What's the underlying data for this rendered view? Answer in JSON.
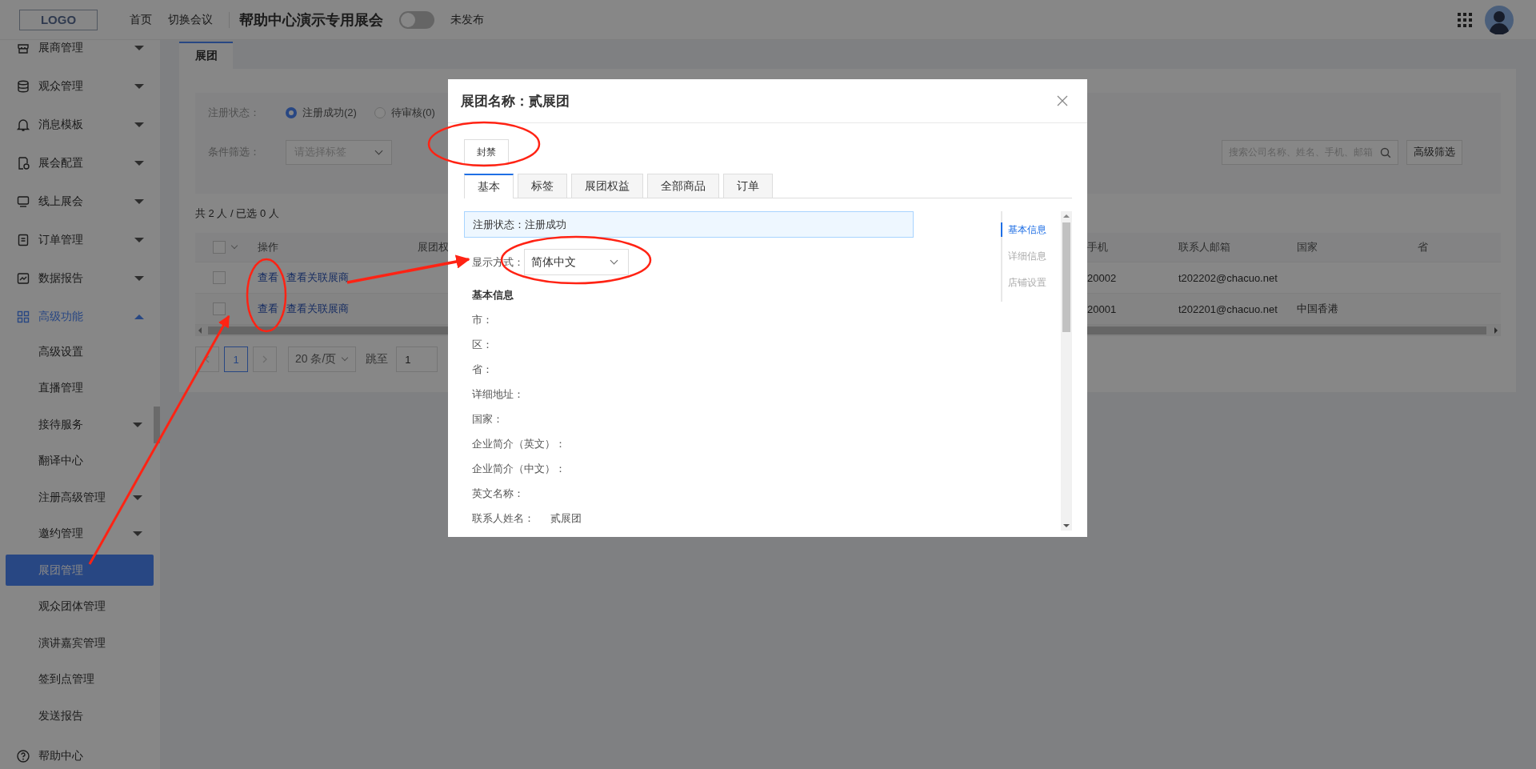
{
  "header": {
    "logo": "LOGO",
    "nav": [
      {
        "label": "首页"
      },
      {
        "label": "切换会议"
      }
    ],
    "event_title": "帮助中心演示专用展会",
    "publish_toggle": {
      "on": false
    },
    "publish_status": "未发布"
  },
  "sidebar": {
    "items": [
      {
        "label": "展商管理",
        "kind": "menu",
        "expanded": false
      },
      {
        "label": "观众管理",
        "kind": "menu",
        "expanded": false
      },
      {
        "label": "消息模板",
        "kind": "menu",
        "expanded": false
      },
      {
        "label": "展会配置",
        "kind": "menu",
        "expanded": false
      },
      {
        "label": "线上展会",
        "kind": "menu",
        "expanded": false
      },
      {
        "label": "订单管理",
        "kind": "menu",
        "expanded": false
      },
      {
        "label": "数据报告",
        "kind": "menu",
        "expanded": false
      },
      {
        "label": "高级功能",
        "kind": "menu",
        "expanded": true,
        "children": [
          {
            "label": "高级设置",
            "kind": "page",
            "selected": false
          },
          {
            "label": "直播管理",
            "kind": "page",
            "selected": false
          },
          {
            "label": "接待服务",
            "kind": "menu",
            "expanded": false,
            "selected": false
          },
          {
            "label": "翻译中心",
            "kind": "page",
            "selected": false
          },
          {
            "label": "注册高级管理",
            "kind": "menu",
            "expanded": false,
            "selected": false
          },
          {
            "label": "邀约管理",
            "kind": "menu",
            "expanded": false,
            "selected": false
          },
          {
            "label": "展团管理",
            "kind": "page",
            "selected": true
          },
          {
            "label": "观众团体管理",
            "kind": "page",
            "selected": false
          },
          {
            "label": "演讲嘉宾管理",
            "kind": "page",
            "selected": false
          },
          {
            "label": "签到点管理",
            "kind": "page",
            "selected": false
          },
          {
            "label": "发送报告",
            "kind": "page",
            "selected": false
          }
        ]
      },
      {
        "label": "帮助中心",
        "kind": "page"
      }
    ]
  },
  "page_tabs": [
    {
      "label": "展团",
      "selected": true
    }
  ],
  "filters": {
    "status_label": "注册状态：",
    "status_options": [
      {
        "label": "注册成功(2)",
        "selected": true
      },
      {
        "label": "待审核(0)",
        "selected": false
      }
    ],
    "condition_label": "条件筛选：",
    "tag_select": {
      "placeholder": "请选择标签"
    },
    "search": {
      "placeholder": "搜索公司名称、姓名、手机、邮箱"
    },
    "advanced_button": "高级筛选"
  },
  "summary": "共 2 人 / 已选 0 人",
  "table": {
    "select_all": {
      "checked": false
    },
    "columns": [
      "操作",
      "展团权",
      "手机",
      "联系人邮箱",
      "国家",
      "省"
    ],
    "rows": [
      {
        "checked": false,
        "actions": [
          "查看",
          "查看关联展商"
        ],
        "phone": "20002",
        "email": "t202202@chacuo.net"
      },
      {
        "checked": false,
        "actions": [
          "查看",
          "查看关联展商"
        ],
        "phone": "20001",
        "email": "t202201@chacuo.net",
        "country": "中国香港"
      }
    ]
  },
  "pagination": {
    "pages": [
      {
        "label": "1",
        "selected": true
      }
    ],
    "page_size": "20 条/页",
    "jump_label": "跳至",
    "jump_value": "1"
  },
  "modal": {
    "title": "展团名称：贰展团",
    "ban_button": "封禁",
    "tabs": [
      {
        "label": "基本",
        "selected": true
      },
      {
        "label": "标签",
        "selected": false
      },
      {
        "label": "展团权益",
        "selected": false
      },
      {
        "label": "全部商品",
        "selected": false
      },
      {
        "label": "订单",
        "selected": false
      }
    ],
    "status_notice": "注册状态：注册成功",
    "display_label": "显示方式：",
    "display_select": {
      "value": "简体中文"
    },
    "section_title": "基本信息",
    "fields": [
      {
        "label": "市："
      },
      {
        "label": "区："
      },
      {
        "label": "省："
      },
      {
        "label": "详细地址："
      },
      {
        "label": "国家："
      },
      {
        "label": "企业简介（英文）："
      },
      {
        "label": "企业简介（中文）："
      },
      {
        "label": "英文名称："
      },
      {
        "label": "联系人姓名：",
        "value": "贰展团"
      }
    ],
    "anchors": [
      {
        "label": "基本信息",
        "selected": true
      },
      {
        "label": "详细信息",
        "selected": false
      },
      {
        "label": "店铺设置",
        "selected": false
      }
    ]
  }
}
